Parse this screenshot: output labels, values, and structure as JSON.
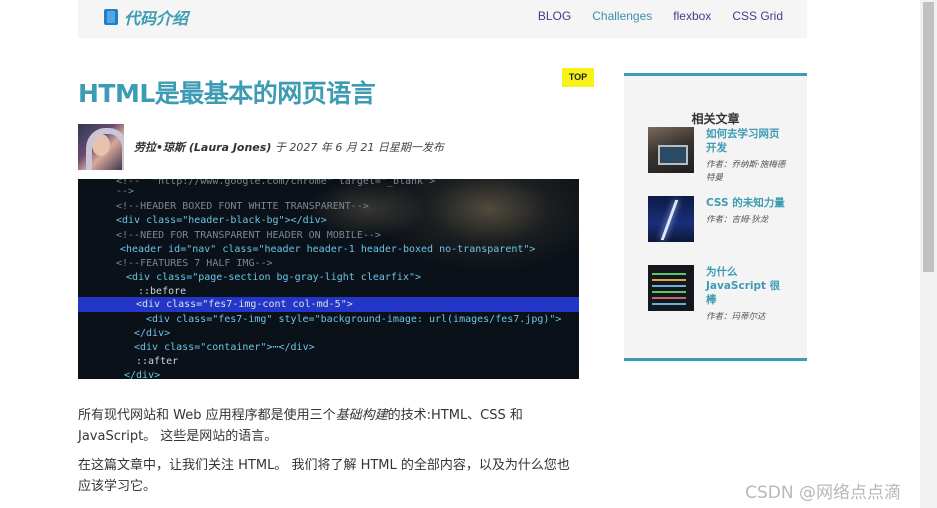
{
  "header": {
    "logo_text": "代码介绍",
    "nav": [
      "BLOG",
      "Challenges",
      "flexbox",
      "CSS Grid"
    ]
  },
  "article": {
    "title": "HTML是最基本的网页语言",
    "badge": "TOP",
    "author": "劳拉•琼斯 (Laura Jones)",
    "date_text": "于 2027 年 6 月 21 日星期一发布",
    "paragraph1_a": "所有现代网站和 Web 应用程序都是使用三个",
    "paragraph1_em": "基础构建",
    "paragraph1_b": "的技术:HTML、CSS 和 JavaScript。 这些是网站的语言。",
    "paragraph2": "在这篇文章中，让我们关注 HTML。 我们将了解 HTML 的全部内容，以及为什么您也应该学习它。"
  },
  "code_image": {
    "lines": [
      "<!--  \"http://www.google.com/chrome\" target=\"_blank\">",
      "-->",
      "<!--HEADER BOXED FONT WHITE TRANSPARENT-->",
      "<div class=\"header-black-bg\"></div>",
      "<!--NEED FOR TRANSPARENT HEADER ON MOBILE-->",
      "<header id=\"nav\" class=\"header header-1 header-boxed no-transparent\">",
      "<!--FEATURES 7 HALF IMG-->",
      "<div class=\"page-section bg-gray-light clearfix\">",
      "::before",
      "<div class=\"fes7-img-cont col-md-5\">",
      "<div class=\"fes7-img\" style=\"background-image: url(images/fes7.jpg)\">",
      "</div>",
      "<div class=\"container\">⋯</div>",
      "::after",
      "</div>"
    ]
  },
  "sidebar": {
    "title": "相关文章",
    "items": [
      {
        "title": "如何去学习网页开发",
        "author": "作者：乔纳斯·施梅德特曼"
      },
      {
        "title": "CSS 的未知力量",
        "author": "作者：吉姆·狄龙"
      },
      {
        "title": "为什么 JavaScript 很棒",
        "author": "作者：玛蒂尔达"
      }
    ]
  },
  "watermark": "CSDN @网络点点滴"
}
